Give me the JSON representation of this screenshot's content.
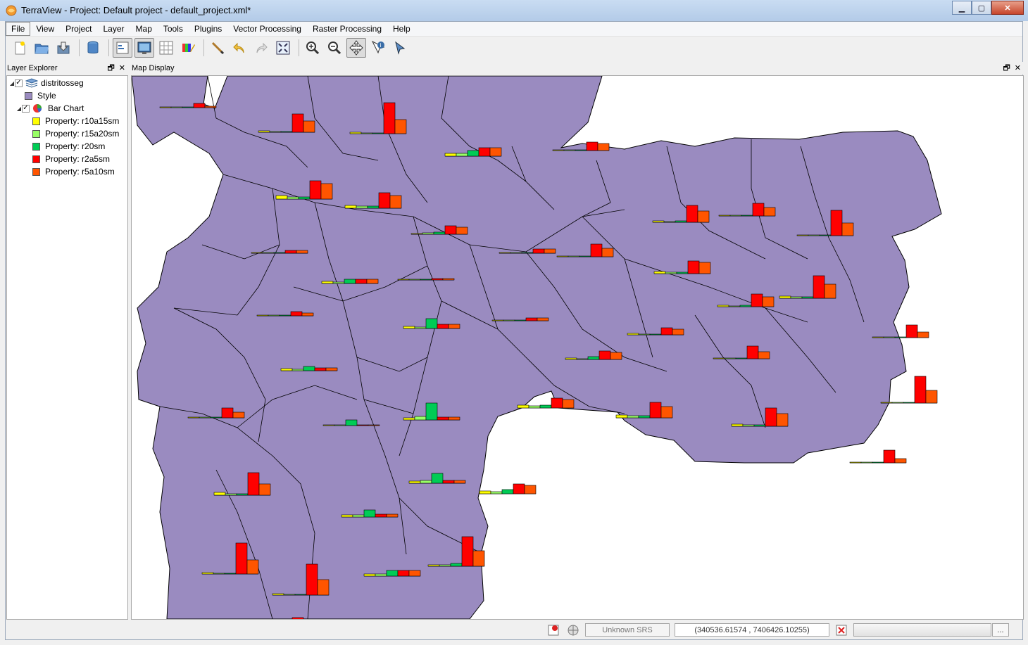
{
  "window": {
    "title": "TerraView - Project: Default project - default_project.xml*"
  },
  "menu": [
    "File",
    "View",
    "Project",
    "Layer",
    "Map",
    "Tools",
    "Plugins",
    "Vector Processing",
    "Raster Processing",
    "Help"
  ],
  "layer_explorer": {
    "title": "Layer Explorer",
    "layer_name": "distritosseg",
    "style_label": "Style",
    "chart_label": "Bar Chart",
    "properties": [
      {
        "label": "Property: r10a15sm",
        "color": "#ffff00"
      },
      {
        "label": "Property: r15a20sm",
        "color": "#99ff66"
      },
      {
        "label": "Property: r20sm",
        "color": "#00cc55"
      },
      {
        "label": "Property: r2a5sm",
        "color": "#ff0000"
      },
      {
        "label": "Property: r5a10sm",
        "color": "#ff5500"
      }
    ]
  },
  "map_display": {
    "title": "Map Display",
    "fill_color": "#9a8bc0"
  },
  "status": {
    "srs": "Unknown SRS",
    "coords": "(340536.61574 , 7406426.10255)",
    "more": "..."
  },
  "icons": [
    "new-project-icon",
    "open-project-icon",
    "save-project-icon",
    "database-icon",
    "layer-explorer-icon",
    "map-display-icon",
    "grid-icon",
    "style-icon",
    "draw-icon",
    "undo-icon",
    "redo-icon",
    "zoom-extent-icon",
    "zoom-in-icon",
    "zoom-out-icon",
    "pan-icon",
    "info-icon",
    "select-icon"
  ]
}
